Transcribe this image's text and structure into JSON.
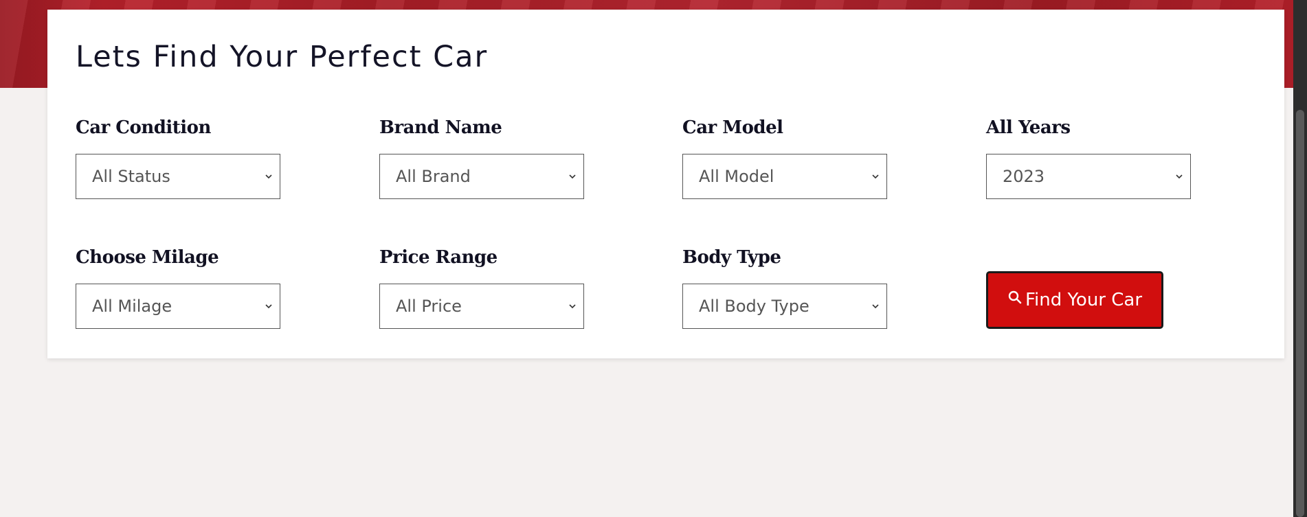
{
  "search": {
    "title": "Lets Find Your Perfect Car",
    "fields": [
      {
        "label": "Car Condition",
        "value": "All Status"
      },
      {
        "label": "Brand Name",
        "value": "All Brand"
      },
      {
        "label": "Car Model",
        "value": "All Model"
      },
      {
        "label": "All Years",
        "value": "2023"
      },
      {
        "label": "Choose Milage",
        "value": "All Milage"
      },
      {
        "label": "Price Range",
        "value": "All Price"
      },
      {
        "label": "Body Type",
        "value": "All Body Type"
      }
    ],
    "button_label": "Find Your Car",
    "button_icon": "search-icon"
  },
  "colors": {
    "accent": "#d10e0e",
    "hero": "#b8212b",
    "background": "#f4f1f0"
  }
}
